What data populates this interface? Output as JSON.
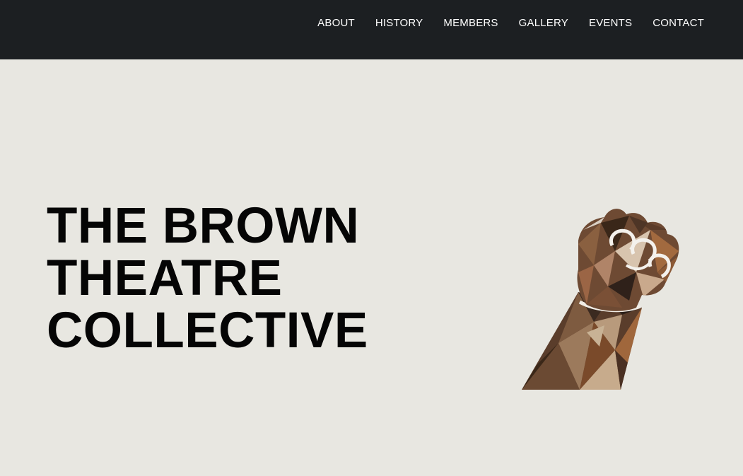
{
  "nav": {
    "items": [
      {
        "label": "ABOUT"
      },
      {
        "label": "HISTORY"
      },
      {
        "label": "MEMBERS"
      },
      {
        "label": "GALLERY"
      },
      {
        "label": "EVENTS"
      },
      {
        "label": "CONTACT"
      }
    ]
  },
  "hero": {
    "title_lines": [
      "THE BROWN",
      "THEATRE",
      "COLLECTIVE"
    ]
  },
  "colors": {
    "header_bg": "#1c1f22",
    "page_bg": "#e8e7e1",
    "title_text": "#050505",
    "nav_text": "#ffffff"
  },
  "icons": {
    "hero_graphic": "raised-fist-icon"
  }
}
